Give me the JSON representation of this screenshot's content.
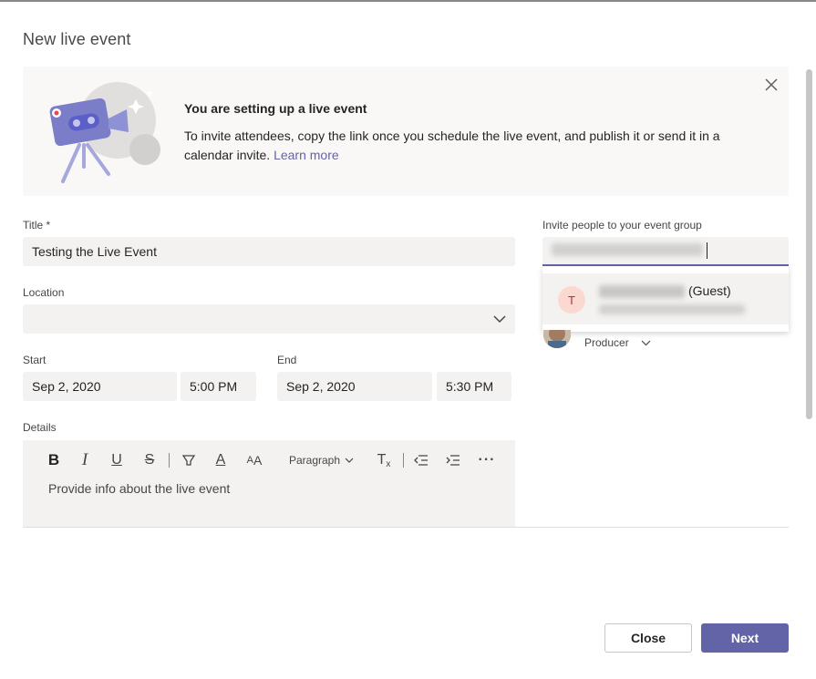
{
  "dialog": {
    "title": "New live event"
  },
  "banner": {
    "heading": "You are setting up a live event",
    "body": "To invite attendees, copy the link once you schedule the live event, and publish it or send it in a calendar invite.",
    "link": "Learn more",
    "close_icon": "close-icon"
  },
  "form": {
    "title_label": "Title *",
    "title_value": "Testing the Live Event",
    "location_label": "Location",
    "location_value": "",
    "start_label": "Start",
    "start_date": "Sep 2, 2020",
    "start_time": "5:00 PM",
    "end_label": "End",
    "end_date": "Sep 2, 2020",
    "end_time": "5:30 PM",
    "details_label": "Details",
    "details_placeholder": "Provide info about the live event"
  },
  "toolbar": {
    "paragraph_label": "Paragraph",
    "icons": [
      "bold-icon",
      "italic-icon",
      "underline-icon",
      "strikethrough-icon",
      "highlight-icon",
      "font-color-icon",
      "font-size-icon",
      "clear-formatting-icon",
      "decrease-indent-icon",
      "increase-indent-icon",
      "more-options-icon"
    ]
  },
  "invite": {
    "label": "Invite people to your event group",
    "suggestion": {
      "avatar_initial": "T",
      "guest_tag": "(Guest)"
    },
    "member_role": "Producer"
  },
  "buttons": {
    "close": "Close",
    "next": "Next"
  },
  "colors": {
    "accent": "#6264a7",
    "field_bg": "#f3f2f1",
    "banner_bg": "#f9f8f7"
  }
}
